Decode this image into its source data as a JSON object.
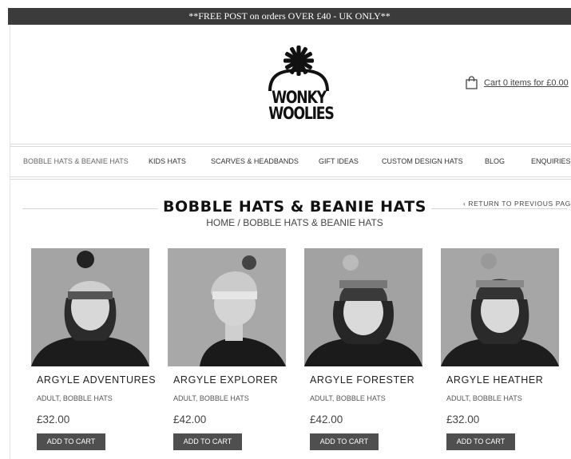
{
  "promo": {
    "text": "**FREE POST on orders OVER £40 - UK ONLY**"
  },
  "logo": {
    "line1": "WONKY",
    "line2": "WOOLIES"
  },
  "cart": {
    "text": "Cart 0 items for £0.00",
    "icon": "shopping-bag-icon"
  },
  "nav": {
    "items": [
      {
        "label": "BOBBLE HATS & BEANIE HATS",
        "active": true
      },
      {
        "label": "KIDS HATS"
      },
      {
        "label": "SCARVES & HEADBANDS"
      },
      {
        "label": "GIFT IDEAS"
      },
      {
        "label": "CUSTOM DESIGN HATS"
      },
      {
        "label": "BLOG"
      },
      {
        "label": "ENQUIRIES"
      }
    ]
  },
  "page": {
    "title": "BOBBLE HATS & BEANIE HATS",
    "breadcrumb": "HOME / BOBBLE HATS & BEANIE HATS",
    "return_link": "‹ RETURN TO PREVIOUS PAGE"
  },
  "products": [
    {
      "name": "ARGYLE ADVENTURES",
      "categories": "ADULT, BOBBLE HATS",
      "price": "£32.00",
      "button": "ADD TO CART"
    },
    {
      "name": "ARGYLE EXPLORER",
      "categories": "ADULT, BOBBLE HATS",
      "price": "£42.00",
      "button": "ADD TO CART"
    },
    {
      "name": "ARGYLE FORESTER",
      "categories": "ADULT, BOBBLE HATS",
      "price": "£42.00",
      "button": "ADD TO CART"
    },
    {
      "name": "ARGYLE HEATHER",
      "categories": "ADULT, BOBBLE HATS",
      "price": "£32.00",
      "button": "ADD TO CART"
    }
  ]
}
